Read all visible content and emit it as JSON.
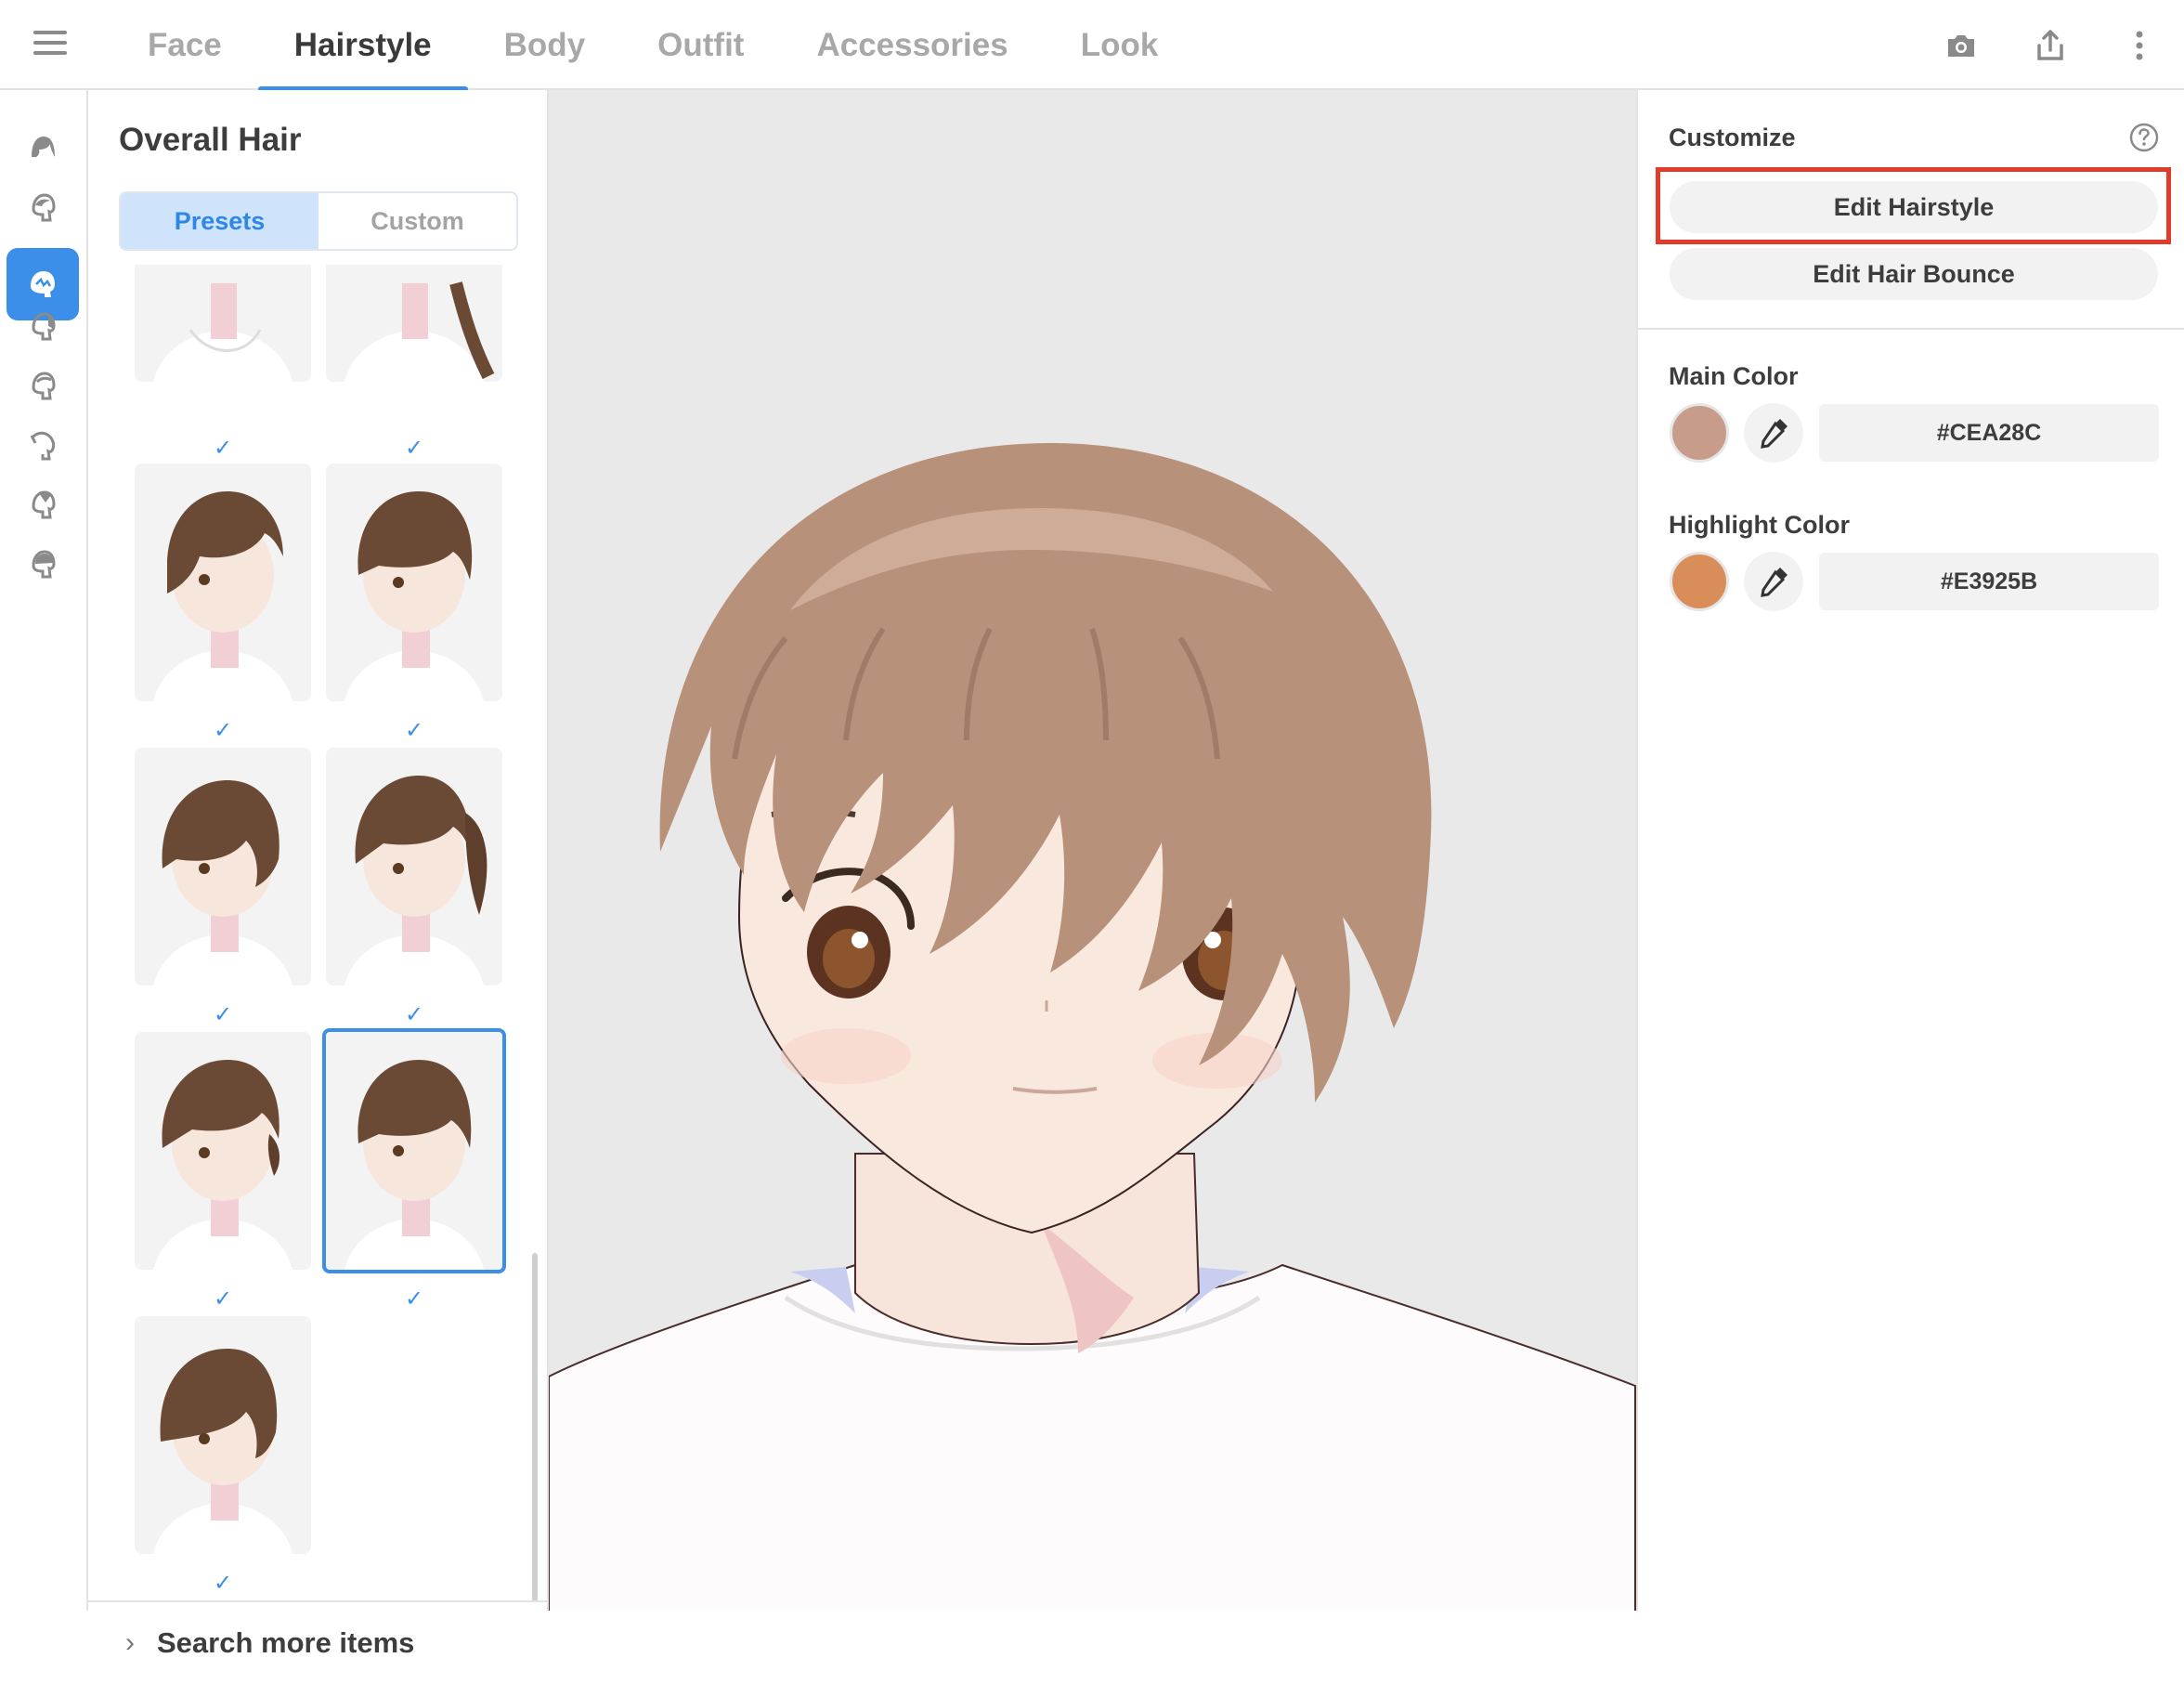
{
  "nav": {
    "tabs": [
      {
        "label": "Face"
      },
      {
        "label": "Hairstyle"
      },
      {
        "label": "Body"
      },
      {
        "label": "Outfit"
      },
      {
        "label": "Accessories"
      },
      {
        "label": "Look"
      }
    ],
    "active_tab": "Hairstyle",
    "actions": [
      "camera-icon",
      "share-icon",
      "more-vertical-icon"
    ]
  },
  "rail": {
    "items": [
      "hair-overall-icon",
      "hair-front-icon",
      "hair-side-icon",
      "hair-style-icon",
      "hair-back-icon",
      "hair-ahoge-icon",
      "hair-extra-icon",
      "hair-accessory-icon",
      "hair-other-icon"
    ],
    "active_index": 3
  },
  "panel": {
    "title": "Overall Hair",
    "segments": {
      "presets": "Presets",
      "custom": "Custom",
      "active": "Presets"
    },
    "presets": [
      {
        "style": "partial-top-a",
        "checked": true
      },
      {
        "style": "partial-top-b-long",
        "checked": true
      },
      {
        "style": "short-layered",
        "checked": true
      },
      {
        "style": "short-bob",
        "checked": true
      },
      {
        "style": "short-wavy",
        "checked": true
      },
      {
        "style": "side-ponytail",
        "checked": true
      },
      {
        "style": "short-tied",
        "checked": true
      },
      {
        "style": "short-bob-dark",
        "checked": true,
        "selected": true
      },
      {
        "style": "short-messy",
        "checked": true
      }
    ],
    "check_glyph": "✓",
    "search_more": "Search more items"
  },
  "customize": {
    "title": "Customize",
    "edit_hairstyle": "Edit Hairstyle",
    "edit_hair_bounce": "Edit Hair Bounce",
    "main_color_label": "Main Color",
    "main_color": "#CEA28C",
    "highlight_color_label": "Highlight Color",
    "highlight_color": "#E3925B"
  },
  "colors": {
    "accent": "#3b8fe8",
    "highlight_frame": "#e13b2a",
    "hair": "#b8917a",
    "preview_bg": "#e9e9e9"
  }
}
